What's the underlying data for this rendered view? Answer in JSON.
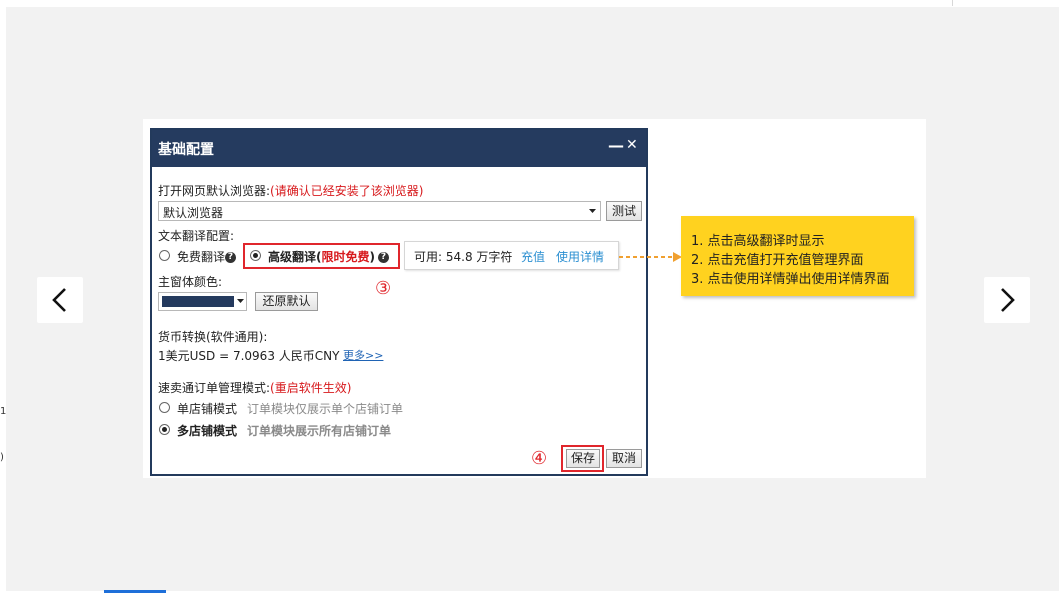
{
  "dialog": {
    "title": "基础配置",
    "minimize": "—",
    "close": "✕"
  },
  "browser": {
    "label": "打开网页默认浏览器:",
    "note": "(请确认已经安装了该浏览器)",
    "value": "默认浏览器",
    "test_button": "测试"
  },
  "translate": {
    "label": "文本翻译配置:",
    "free_option": "免费翻译",
    "advanced_option": "高级翻译(",
    "limited_free": "限时免费",
    "advanced_close": ")",
    "help_icon": "?"
  },
  "quota": {
    "available": "可用: 54.8 万字符",
    "recharge": "充值",
    "usage_detail": "使用详情"
  },
  "theme": {
    "label": "主窗体颜色:",
    "color": "#243a5e",
    "reset_button": "还原默认"
  },
  "currency": {
    "label": "货币转换(软件通用):",
    "rate": "1美元USD = 7.0963 人民币CNY",
    "more_link": "更多>>"
  },
  "order_mode": {
    "label": "速卖通订单管理模式:",
    "note": "(重启软件生效)",
    "single_label": "单店铺模式",
    "single_desc": "订单模块仅展示单个店铺订单",
    "multi_label": "多店铺模式",
    "multi_desc": "订单模块展示所有店铺订单"
  },
  "footer": {
    "save": "保存",
    "cancel": "取消"
  },
  "annotations": {
    "step3": "③",
    "step4": "④",
    "tips": [
      "1. 点击高级翻译时显示",
      "2. 点击充值打开充值管理界面",
      "3. 点击使用详情弹出使用详情界面"
    ]
  },
  "edge_marks": {
    "mark1": "1",
    "mark2": ")"
  },
  "icons": {
    "prev": "chevron-left-icon",
    "next": "chevron-right-icon",
    "dropdown": "caret-down-icon",
    "help": "question-circle-icon"
  },
  "colors": {
    "title_bar": "#253b5f",
    "highlight_red": "#e0262c",
    "tip_yellow": "#ffd21f",
    "link_blue": "#2b8fd1"
  }
}
